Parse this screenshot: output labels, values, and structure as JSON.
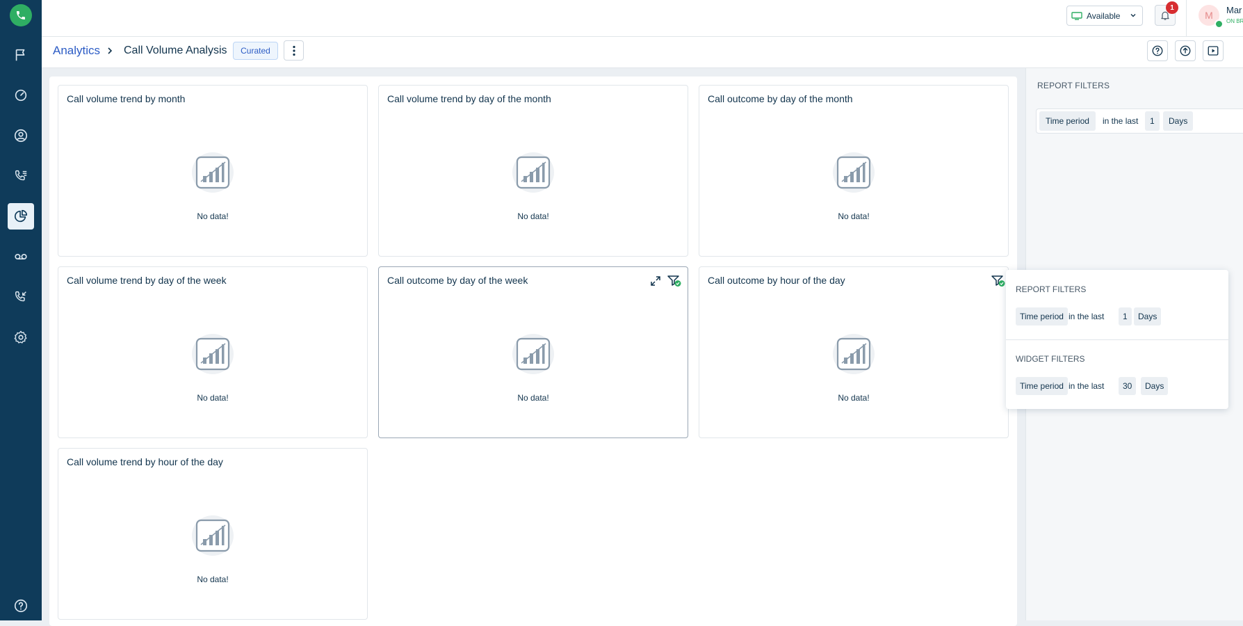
{
  "top_bar": {
    "availability": "Available",
    "notification_count": "1",
    "user_initial": "M",
    "user_name": "Mar",
    "user_status": "ON BR"
  },
  "header": {
    "breadcrumb": "Analytics",
    "title": "Call Volume Analysis",
    "curated_badge": "Curated"
  },
  "sidebar": {
    "items": [
      "flag-icon",
      "dashboard-icon",
      "contacts-icon",
      "call-log-icon",
      "analytics-icon",
      "voicemail-icon",
      "callback-icon",
      "settings-icon",
      "help-icon"
    ]
  },
  "widgets": [
    {
      "title": "Call volume trend by month",
      "empty_text": "No data!"
    },
    {
      "title": "Call volume trend by day of the month",
      "empty_text": "No data!"
    },
    {
      "title": "Call outcome by day of the month",
      "empty_text": "No data!"
    },
    {
      "title": "Call volume trend by day of the week",
      "empty_text": "No data!"
    },
    {
      "title": "Call outcome by day of the week",
      "empty_text": "No data!"
    },
    {
      "title": "Call outcome by hour of the day",
      "empty_text": "No data!"
    },
    {
      "title": "Call volume trend by hour of the day",
      "empty_text": "No data!"
    }
  ],
  "report_filters_panel": {
    "title": "REPORT FILTERS",
    "field": "Time period",
    "operator": "in the last",
    "value": "1",
    "unit": "Days"
  },
  "filter_popover": {
    "report_title": "REPORT FILTERS",
    "report_field": "Time period",
    "report_operator": "in the last",
    "report_value": "1",
    "report_unit": "Days",
    "widget_title": "WIDGET FILTERS",
    "widget_field": "Time period",
    "widget_operator": "in the last",
    "widget_value": "30",
    "widget_unit": "Days"
  },
  "colors": {
    "sidebar": "#0f3b5a",
    "brand_green": "#2fae63",
    "link_blue": "#2c5cc5",
    "badge_red": "#d72d30"
  }
}
